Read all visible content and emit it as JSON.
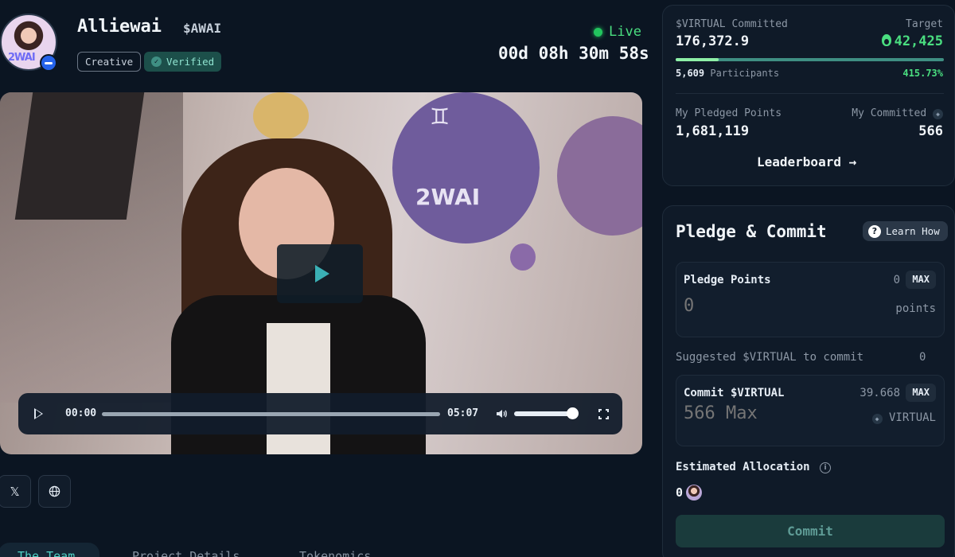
{
  "header": {
    "name": "Alliewai",
    "ticker": "$AWAI",
    "avatar_logo_text": "2WAI",
    "tags": {
      "creative": "Creative",
      "verified": "Verified"
    },
    "live_label": "Live",
    "countdown": "00d 08h 30m 58s"
  },
  "video": {
    "overlay_text": "2WAI",
    "current_time": "00:00",
    "duration": "05:07",
    "progress": 0,
    "volume": 1.0
  },
  "social": {
    "x_label": "𝕏",
    "globe_label": "🌐"
  },
  "tabs": [
    {
      "label": "The Team",
      "active": true
    },
    {
      "label": "Project Details",
      "active": false
    },
    {
      "label": "Tokenomics",
      "active": false
    }
  ],
  "stats": {
    "committed_label": "$VIRTUAL Committed",
    "committed_value": "176,372.9",
    "target_label": "Target",
    "target_value": "42,425",
    "participants_count": "5,609",
    "participants_label": "Participants",
    "percent": "415.73%",
    "progress_fill_fraction": 0.16,
    "my_pledged_label": "My Pledged Points",
    "my_pledged_value": "1,681,119",
    "my_committed_label": "My Committed",
    "my_committed_value": "566",
    "leaderboard_label": "Leaderboard →"
  },
  "pledge": {
    "title": "Pledge & Commit",
    "learn_how": "Learn How",
    "pledge_label": "Pledge Points",
    "pledge_balance": "0",
    "pledge_max": "MAX",
    "pledge_placeholder": "0",
    "pledge_unit": "points",
    "suggested_label": "Suggested $VIRTUAL to commit",
    "suggested_value": "0",
    "commit_label": "Commit $VIRTUAL",
    "commit_balance": "39.668",
    "commit_max": "MAX",
    "commit_placeholder": "566 Max",
    "commit_unit": "VIRTUAL",
    "estimated_label": "Estimated Allocation",
    "estimated_value": "0",
    "commit_button": "Commit"
  },
  "colors": {
    "background": "#0b1522",
    "accent_green": "#4ade80",
    "accent_teal": "#3f8f83",
    "panel": "#0f1a28"
  },
  "icons": [
    "verified-check-icon",
    "live-dot-icon",
    "play-icon",
    "volume-icon",
    "fullscreen-icon",
    "x-icon",
    "globe-icon",
    "flame-icon",
    "virtual-coin-icon",
    "arrow-right-icon",
    "help-icon",
    "info-icon"
  ]
}
